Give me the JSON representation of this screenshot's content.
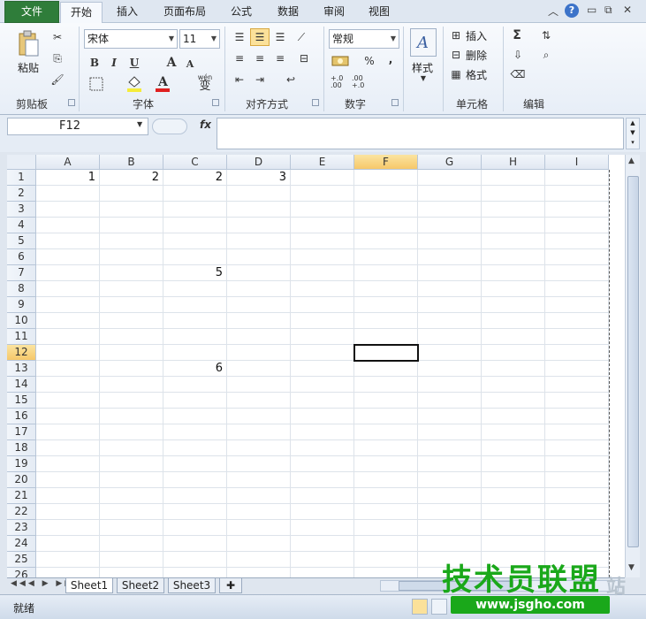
{
  "menu": {
    "file": "文件",
    "tabs": [
      "开始",
      "插入",
      "页面布局",
      "公式",
      "数据",
      "审阅",
      "视图"
    ],
    "active_tab": "开始"
  },
  "ribbon": {
    "clipboard": {
      "paste": "粘贴",
      "label": "剪贴板"
    },
    "font": {
      "name": "宋体",
      "size": "11",
      "bold": "B",
      "italic": "I",
      "underline": "U",
      "grow": "A",
      "shrink": "A",
      "wen": "wén",
      "wen_char": "变",
      "label": "字体"
    },
    "alignment": {
      "label": "对齐方式"
    },
    "number": {
      "format": "常规",
      "percent": "%",
      "comma": ",",
      "inc": "+.0 .00",
      "dec": ".00 +.0",
      "label": "数字"
    },
    "styles": {
      "label": "样式"
    },
    "cells": {
      "insert": "插入",
      "delete": "删除",
      "format": "格式",
      "label": "单元格"
    },
    "editing": {
      "label": "编辑"
    }
  },
  "formula_bar": {
    "name_box": "F12",
    "fx": "fx",
    "content": ""
  },
  "grid": {
    "columns": [
      "A",
      "B",
      "C",
      "D",
      "E",
      "F",
      "G",
      "H",
      "I"
    ],
    "rows": [
      "1",
      "2",
      "3",
      "4",
      "5",
      "6",
      "7",
      "8",
      "9",
      "10",
      "11",
      "12",
      "13",
      "14",
      "15",
      "16",
      "17",
      "18",
      "19",
      "20",
      "21",
      "22",
      "23",
      "24",
      "25",
      "26"
    ],
    "selected_column": "F",
    "selected_row": "12",
    "cells": [
      {
        "ref": "A1",
        "value": "1"
      },
      {
        "ref": "B1",
        "value": "2"
      },
      {
        "ref": "C1",
        "value": "2"
      },
      {
        "ref": "D1",
        "value": "3"
      },
      {
        "ref": "C7",
        "value": "5"
      },
      {
        "ref": "C13",
        "value": "6"
      }
    ]
  },
  "sheets": [
    "Sheet1",
    "Sheet2",
    "Sheet3"
  ],
  "active_sheet": "Sheet1",
  "status": {
    "ready": "就绪"
  },
  "watermark": {
    "title": "技术员联盟",
    "url": "www.jsgho.com",
    "side": "站"
  }
}
